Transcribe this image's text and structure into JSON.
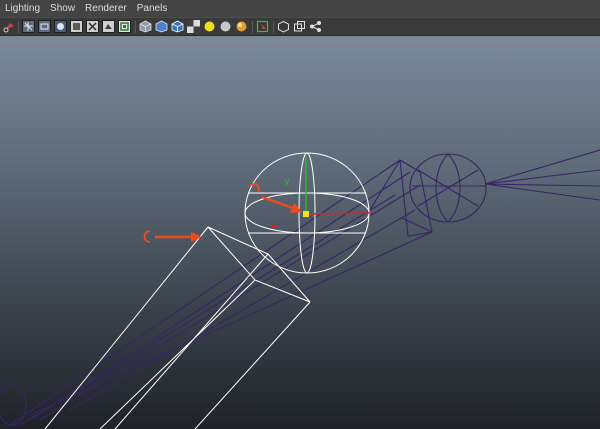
{
  "menubar": {
    "items": [
      {
        "label": "Lighting"
      },
      {
        "label": "Show"
      },
      {
        "label": "Renderer"
      },
      {
        "label": "Panels"
      }
    ]
  },
  "toolbar": {
    "icons": [
      "camera-settings-icon",
      "wireframe-icon",
      "bounding-box-icon",
      "smooth-shade-icon",
      "flat-shade-icon",
      "xray-icon",
      "texture-icon",
      "camera-view-icon",
      "cube-shaded-icon",
      "cube-wire-icon",
      "checker-icon",
      "default-light-icon",
      "all-lights-icon",
      "shadows-icon",
      "select-camera-icon",
      "isolate-icon",
      "frame-all-icon",
      "share-icon"
    ]
  },
  "viewport": {
    "manipulator_axis_label": "y",
    "colors": {
      "selected_wire": "#ffffff",
      "unselected_wire": "#3a2466",
      "x_axis": "#e02020",
      "y_axis": "#20c020",
      "z_axis": "#2040e0",
      "annotation_arrow": "#f04a1c"
    }
  }
}
